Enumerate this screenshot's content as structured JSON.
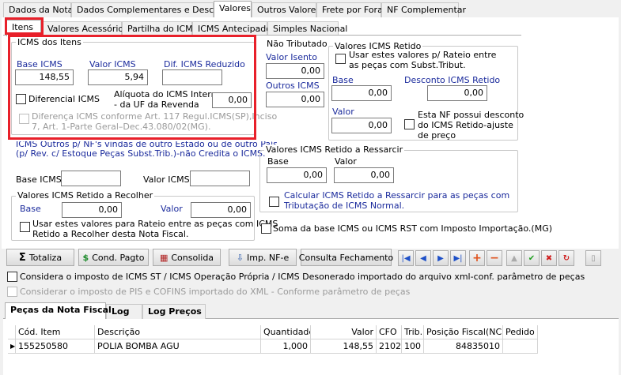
{
  "top_tabs": [
    "Dados da Nota",
    "Dados Complementares e Desconto",
    "Valores",
    "Outros Valores",
    "Frete por Fora",
    "NF Complementar"
  ],
  "sub_tabs": [
    "Itens",
    "Valores Acessórios",
    "Partilha do ICMS",
    "ICMS Antecipado",
    "Simples Nacional"
  ],
  "icms_itens": {
    "title": "ICMS dos Itens",
    "base_label": "Base ICMS",
    "base_value": "148,55",
    "valor_label": "Valor ICMS",
    "valor_value": "5,94",
    "dif_label": "Dif. ICMS Reduzido",
    "dif_value": "",
    "diferencial_label": "Diferencial ICMS",
    "aliquota_label_1": "Alíquota do ICMS Interna",
    "aliquota_label_2": "- da UF da Revenda",
    "aliquota_value": "0,00",
    "diferenca_line1": "Diferença ICMS conforme Art. 117 Regul.ICMS(SP),Inciso",
    "diferenca_line2": "7, Art. 1-Parte Geral–Dec.43.080/02(MG)."
  },
  "icms_outros": {
    "line1": "ICMS Outros p/ NF's vindas de outro Estado ou de outro País",
    "line2": "(p/ Rev. c/ Estoque Peças Subst.Trib.)-não Credita o ICMS.",
    "base_label": "Base ICMS",
    "base_value": "",
    "valor_label": "Valor ICMS",
    "valor_value": ""
  },
  "retido_recolher": {
    "title": "Valores ICMS Retido a Recolher",
    "base_label": "Base",
    "base_value": "0,00",
    "valor_label": "Valor",
    "valor_value": "0,00",
    "check_line1": "Usar estes valores para Rateio entre as peças com ICMS",
    "check_line2": "Retido a Recolher desta Nota Fiscal."
  },
  "nao_tributado": {
    "title": "Não Tributado",
    "isento_label": "Valor Isento",
    "isento_value": "0,00",
    "outros_label": "Outros ICMS",
    "outros_value": "0,00"
  },
  "retido": {
    "title": "Valores ICMS Retido",
    "check_line1": "Usar estes valores p/ Rateio  entre",
    "check_line2": "as peças com Subst.Tribut.",
    "base_label": "Base",
    "base_value": "0,00",
    "desconto_label": "Desconto ICMS Retido",
    "desconto_value": "0,00",
    "valor_label": "Valor",
    "valor_value": "0,00",
    "nf_line1": "Esta NF possui desconto",
    "nf_line2": "do ICMS Retido-ajuste",
    "nf_line3": "de preço"
  },
  "ressarcir": {
    "title": "Valores ICMS Retido a Ressarcir",
    "base_label": "Base",
    "base_value": "0,00",
    "valor_label": "Valor",
    "valor_value": "0,00",
    "check_line1": "Calcular ICMS Retido a  Ressarcir para as peças com",
    "check_line2": "Tributação de ICMS Normal."
  },
  "soma_label": "Soma da base ICMS ou ICMS RST com Imposto Importação.(MG)",
  "buttons": {
    "totaliza": "Totaliza",
    "cond_pagto": "Cond. Pagto",
    "consolida": "Consolida",
    "imp_nfe": "Imp. NF-e",
    "consulta": "Consulta Fechamento"
  },
  "considera_icms": "Considera o imposto de ICMS ST / ICMS Operação Própria / ICMS Desonerado importado do arquivo xml-conf. parâmetro de peças",
  "considera_pis": "Considerar o imposto de PIS e COFINS importado do XML - Conforme parâmetro de peças",
  "bottom_tabs": [
    "Peças da Nota Fiscal",
    "Log",
    "Log Preços"
  ],
  "grid": {
    "headers": [
      "Cód. Item",
      "Descrição",
      "Quantidade",
      "Valor",
      "CFO",
      "Trib.",
      "Posição Fiscal(NCM)",
      "Pedido"
    ],
    "rows": [
      [
        "155250580",
        "POLIA BOMBA AGU",
        "1,000",
        "148,55",
        "2102",
        "100",
        "84835010",
        ""
      ]
    ]
  },
  "colors": {
    "highlight": "#e8202a",
    "blue_label": "#1a2a9c"
  }
}
